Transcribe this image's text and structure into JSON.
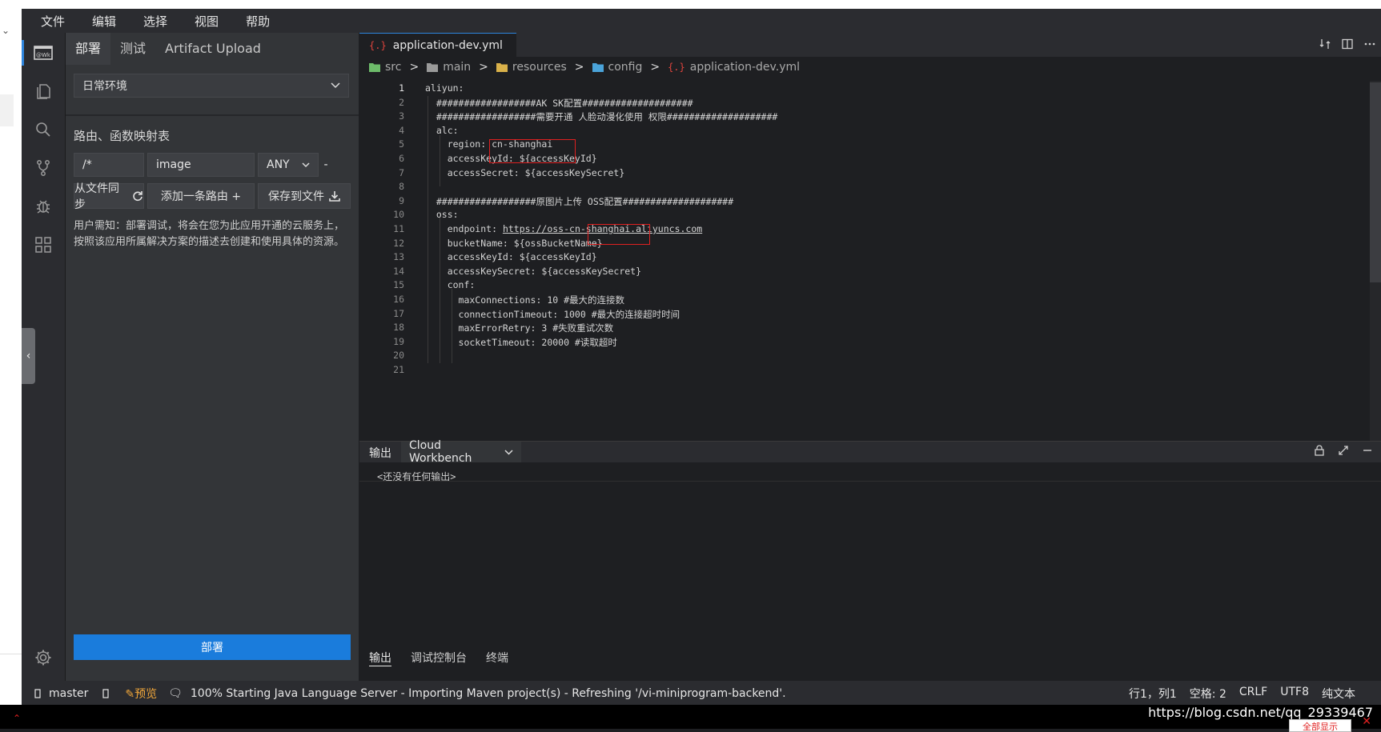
{
  "menubar": {
    "items": [
      "文件",
      "编辑",
      "选择",
      "视图",
      "帮助"
    ]
  },
  "side": {
    "tabs": [
      "部署",
      "测试",
      "Artifact Upload"
    ],
    "env_select": "日常环境",
    "route_title": "路由、函数映射表",
    "route": {
      "path": "/*",
      "target": "image",
      "method": "ANY",
      "extra": "-"
    },
    "buttons": {
      "sync": "从文件同步",
      "add": "添加一条路由 +",
      "save": "保存到文件"
    },
    "notice": "用户需知：部署调试，将会在您为此应用开通的云服务上，按照该应用所属解决方案的描述去创建和使用具体的资源。",
    "deploy": "部署"
  },
  "editor": {
    "tab_label": "application-dev.yml",
    "yml_icon": "{.}",
    "breadcrumb": [
      "src",
      "main",
      "resources",
      "config",
      "application-dev.yml"
    ],
    "lines": [
      "aliyun:",
      "  ##################AK SK配置####################",
      "  ##################需要开通 人脸动漫化使用 权限####################",
      "  alc:",
      "    region: cn-shanghai",
      "    accessKeyId: ${accessKeyId}",
      "    accessSecret: ${accessKeySecret}",
      "",
      "  ##################原图片上传 OSS配置####################",
      "  oss:",
      "    endpoint: ",
      "    bucketName: ${ossBucketName}",
      "    accessKeyId: ${accessKeyId}",
      "    accessKeySecret: ${accessKeySecret}",
      "    conf:",
      "      maxConnections: 10 #最大的连接数",
      "      connectionTimeout: 1000 #最大的连接超时时间",
      "      maxErrorRetry: 3 #失败重试次数",
      "      socketTimeout: 20000 #读取超时",
      "",
      ""
    ],
    "endpoint_url": "https://oss-cn-shanghai.aliyuncs.com"
  },
  "panel": {
    "title": "输出",
    "channel": "Cloud Workbench",
    "empty": "<还没有任何输出>",
    "tabs": [
      "输出",
      "调试控制台",
      "终端"
    ]
  },
  "status": {
    "branch": "master",
    "preview": "预览",
    "message": "100% Starting Java Language Server - Importing Maven project(s) - Refreshing '/vi-miniprogram-backend'.",
    "position": "行1，列1",
    "indent": "空格: 2",
    "eol": "CRLF",
    "encoding": "UTF8",
    "language": "纯文本"
  },
  "bottom": {
    "watermark": "https://blog.csdn.net/qq_29339467",
    "button": "全部显示"
  },
  "colors": {
    "accent": "#1a7cdc",
    "highlight_box": "#e02020",
    "yml_icon": "#e0443d",
    "preview": "#f0a63a"
  }
}
